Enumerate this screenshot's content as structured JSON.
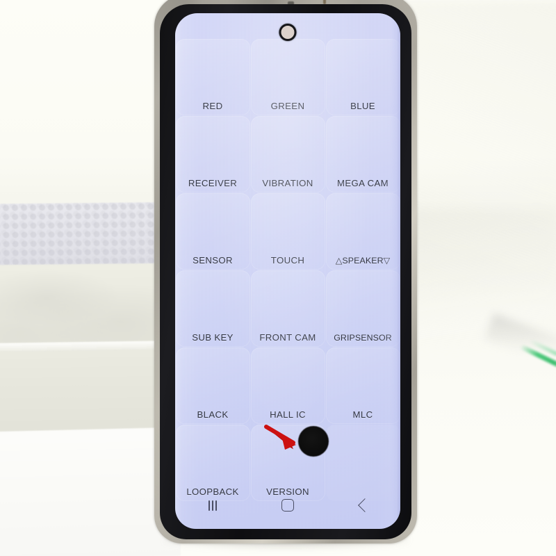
{
  "device": {
    "type": "smartphone",
    "brand_style": "samsung-galaxy",
    "frame_color": "#b8b4aa",
    "bezel_color": "#131316",
    "screen_bg_color": "#d0d5f7",
    "condition_note": "worn metal frame, screen under test"
  },
  "screen": {
    "app_name": "factory-test-menu",
    "text_color": "#2f3340",
    "grid": {
      "rows": 6,
      "columns": 3,
      "items": [
        {
          "label": "RED",
          "row": 1,
          "col": 1
        },
        {
          "label": "GREEN",
          "row": 1,
          "col": 2
        },
        {
          "label": "BLUE",
          "row": 1,
          "col": 3
        },
        {
          "label": "RECEIVER",
          "row": 2,
          "col": 1
        },
        {
          "label": "VIBRATION",
          "row": 2,
          "col": 2
        },
        {
          "label": "MEGA CAM",
          "row": 2,
          "col": 3
        },
        {
          "label": "SENSOR",
          "row": 3,
          "col": 1
        },
        {
          "label": "TOUCH",
          "row": 3,
          "col": 2
        },
        {
          "label": "△SPEAKER▽",
          "row": 3,
          "col": 3
        },
        {
          "label": "SUB KEY",
          "row": 4,
          "col": 1
        },
        {
          "label": "FRONT CAM",
          "row": 4,
          "col": 2
        },
        {
          "label": "GRIPSENSOR",
          "row": 4,
          "col": 3
        },
        {
          "label": "BLACK",
          "row": 5,
          "col": 1
        },
        {
          "label": "HALL IC",
          "row": 5,
          "col": 2
        },
        {
          "label": "MLC",
          "row": 5,
          "col": 3
        },
        {
          "label": "LOOPBACK",
          "row": 6,
          "col": 1
        },
        {
          "label": "VERSION",
          "row": 6,
          "col": 2
        },
        {
          "label": "",
          "row": 6,
          "col": 3
        }
      ]
    },
    "defect": {
      "name": "black-spot-defect",
      "shape": "circle",
      "color": "#0b0b0b",
      "annotation_arrow_color": "#cc1111"
    },
    "navbar": {
      "recents_label": "Recents",
      "home_label": "Home",
      "back_label": "Back"
    },
    "camera": {
      "name": "punch-hole-front-camera"
    }
  },
  "background": {
    "description": "styrofoam packing block on off-white surface",
    "wall_color": "#fcfcf6",
    "foam_color": "#e6e6dc",
    "accent_streak_color": "#4ec97c"
  }
}
